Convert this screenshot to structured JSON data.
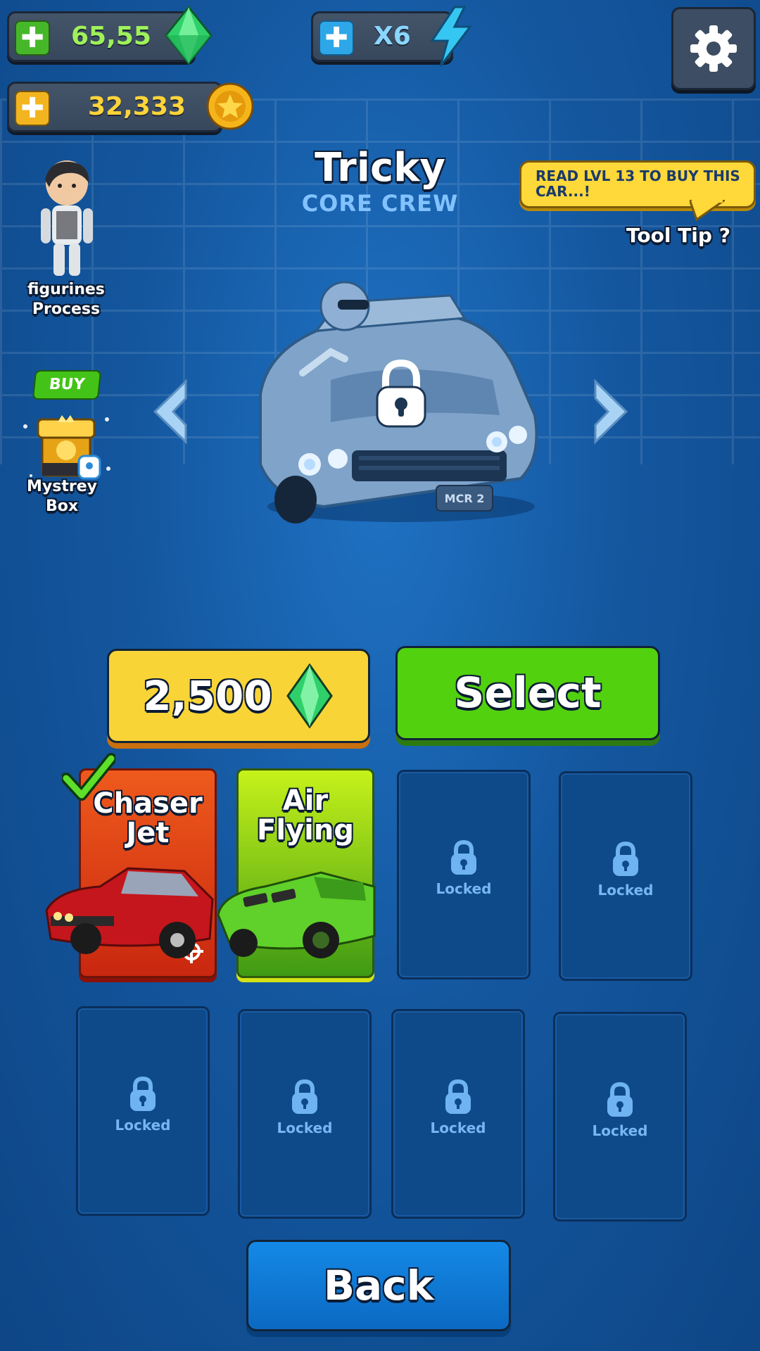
{
  "currency": {
    "gems": "65,55",
    "multiplier": "X6",
    "coins": "32,333"
  },
  "car": {
    "name": "Tricky",
    "crew": "CORE CREW",
    "plate": "MCR 2"
  },
  "tooltip": {
    "message": "READ LVL 13 TO BUY THIS CAR...!",
    "label": "Tool Tip ?"
  },
  "figurine": {
    "label_line1": "figurines",
    "label_line2": "Process"
  },
  "mystery_box": {
    "badge": "BUY",
    "label_line1": "Mystrey",
    "label_line2": "Box"
  },
  "actions": {
    "price": "2,500",
    "select": "Select",
    "back": "Back"
  },
  "cars": [
    {
      "title_line1": "Chaser",
      "title_line2": "Jet",
      "selected": true
    },
    {
      "title_line1": "Air",
      "title_line2": "Flying",
      "selected": false
    }
  ],
  "locked_label": "Locked",
  "colors": {
    "gem_green": "#3fe07a",
    "coin_gold": "#f5b51a",
    "price_yellow": "#f9d437",
    "select_green": "#52d10f",
    "back_blue": "#0b73cc",
    "tooltip_yellow": "#ffd83a"
  }
}
